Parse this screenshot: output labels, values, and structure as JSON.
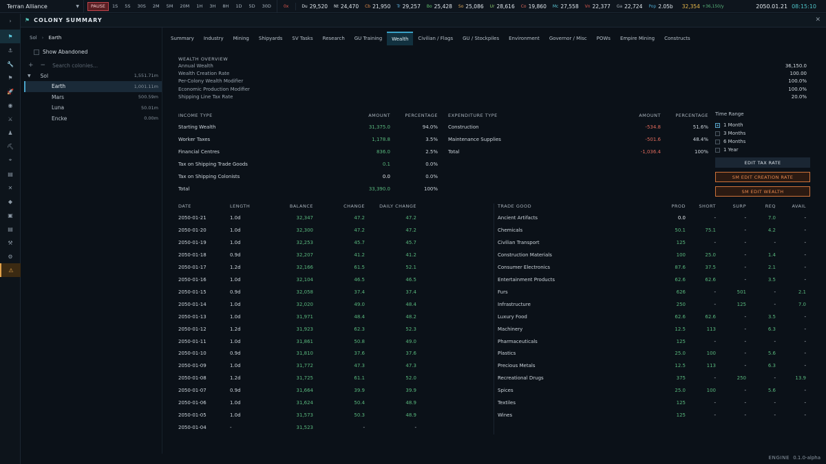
{
  "topbar": {
    "empire": "Terran Alliance",
    "speed_buttons": [
      "PAUSE",
      "1S",
      "5S",
      "30S",
      "2M",
      "5M",
      "20M",
      "1H",
      "3H",
      "8H",
      "1D",
      "5D",
      "30D"
    ],
    "resources": [
      {
        "label": "0x",
        "value": "",
        "color": "#e0584f"
      },
      {
        "label": "Du",
        "value": "29,520",
        "color": "#dfe6ec"
      },
      {
        "label": "Nt",
        "value": "24,470",
        "color": "#dfe6ec"
      },
      {
        "label": "Cb",
        "value": "21,950",
        "color": "#e28a4b"
      },
      {
        "label": "Tr",
        "value": "29,257",
        "color": "#5fb7e8"
      },
      {
        "label": "Bo",
        "value": "25,428",
        "color": "#62c36e"
      },
      {
        "label": "So",
        "value": "25,086",
        "color": "#e0a95a"
      },
      {
        "label": "Ur",
        "value": "28,616",
        "color": "#8fcf6f"
      },
      {
        "label": "Co",
        "value": "19,860",
        "color": "#e06a5c"
      },
      {
        "label": "Mc",
        "value": "27,558",
        "color": "#5bc8d6"
      },
      {
        "label": "Vn",
        "value": "22,377",
        "color": "#e0584f"
      },
      {
        "label": "Ga",
        "value": "22,724",
        "color": "#a6b0b9"
      },
      {
        "label": "Pop",
        "value": "2.05b",
        "color": "#4aa3c9"
      }
    ],
    "wealth": "32,354",
    "wealth_rate": "+36,150/y",
    "date": "2050.01.21",
    "time": "08:15:10"
  },
  "rail_icons": [
    "expand-icon",
    "flag-icon",
    "anchor-icon",
    "wrench-icon",
    "flag-small-icon",
    "rocket-icon",
    "target-icon",
    "swords-icon",
    "person-icon",
    "pickaxe-icon",
    "telescope-icon",
    "clipboard-icon",
    "cross-icon",
    "tag-icon",
    "box-icon",
    "document-icon",
    "tool-icon",
    "gear-icon",
    "warning-icon"
  ],
  "window": {
    "title": "COLONY SUMMARY"
  },
  "left": {
    "breadcrumb": [
      "Sol",
      "Earth"
    ],
    "show_abandoned": "Show Abandoned",
    "search_placeholder": "Search colonies...",
    "tree": [
      {
        "name": "Sol",
        "value": "1,551.71m",
        "indent": 0,
        "expand": "▼"
      },
      {
        "name": "Earth",
        "value": "1,001.11m",
        "indent": 1,
        "selected": true
      },
      {
        "name": "Mars",
        "value": "500.59m",
        "indent": 1
      },
      {
        "name": "Luna",
        "value": "50.01m",
        "indent": 1
      },
      {
        "name": "Encke",
        "value": "0.00m",
        "indent": 1
      }
    ]
  },
  "tabs": [
    "Summary",
    "Industry",
    "Mining",
    "Shipyards",
    "SV Tasks",
    "Research",
    "GU Training",
    "Wealth",
    "Civilian / Flags",
    "GU / Stockpiles",
    "Environment",
    "Governor / Misc",
    "POWs",
    "Empire Mining",
    "Constructs"
  ],
  "active_tab": "Wealth",
  "overview": {
    "title": "WEALTH OVERVIEW",
    "rows": [
      {
        "label": "Annual Wealth",
        "value": "36,150.0"
      },
      {
        "label": "Wealth Creation Rate",
        "value": "100.00"
      },
      {
        "label": "Per-Colony Wealth Modifier",
        "value": "100.0%"
      },
      {
        "label": "Economic Production Modifier",
        "value": "100.0%"
      },
      {
        "label": "Shipping Line Tax Rate",
        "value": "20.0%"
      }
    ]
  },
  "income": {
    "headers": [
      "INCOME TYPE",
      "AMOUNT",
      "PERCENTAGE"
    ],
    "rows": [
      {
        "type": "Starting Wealth",
        "amount": "31,375.0",
        "pct": "94.0%",
        "tone": "g"
      },
      {
        "type": "Worker Taxes",
        "amount": "1,178.8",
        "pct": "3.5%",
        "tone": "g"
      },
      {
        "type": "Financial Centres",
        "amount": "836.0",
        "pct": "2.5%",
        "tone": "g"
      },
      {
        "type": "Tax on Shipping Trade Goods",
        "amount": "0.1",
        "pct": "0.0%",
        "tone": "g"
      },
      {
        "type": "Tax on Shipping Colonists",
        "amount": "0.0",
        "pct": "0.0%",
        "tone": "w"
      },
      {
        "type": "Total",
        "amount": "33,390.0",
        "pct": "100%",
        "tone": "g"
      }
    ]
  },
  "expenditure": {
    "headers": [
      "EXPENDITURE TYPE",
      "AMOUNT",
      "PERCENTAGE"
    ],
    "rows": [
      {
        "type": "Construction",
        "amount": "-534.8",
        "pct": "51.6%"
      },
      {
        "type": "Maintenance Supplies",
        "amount": "-501.6",
        "pct": "48.4%"
      },
      {
        "type": "Total",
        "amount": "-1,036.4",
        "pct": "100%"
      }
    ]
  },
  "time_range": {
    "label": "Time Range",
    "options": [
      "1 Month",
      "3 Months",
      "6 Months",
      "1 Year"
    ],
    "selected": 0
  },
  "buttons": {
    "edit_tax": "EDIT TAX RATE",
    "sm_creation": "SM EDIT CREATION RATE",
    "sm_wealth": "SM EDIT WEALTH"
  },
  "history": {
    "headers": [
      "DATE",
      "LENGTH",
      "BALANCE",
      "CHANGE",
      "DAILY CHANGE"
    ],
    "rows": [
      [
        "2050-01-21",
        "1.0d",
        "32,347",
        "47.2",
        "47.2"
      ],
      [
        "2050-01-20",
        "1.0d",
        "32,300",
        "47.2",
        "47.2"
      ],
      [
        "2050-01-19",
        "1.0d",
        "32,253",
        "45.7",
        "45.7"
      ],
      [
        "2050-01-18",
        "0.9d",
        "32,207",
        "41.2",
        "41.2"
      ],
      [
        "2050-01-17",
        "1.2d",
        "32,166",
        "61.5",
        "52.1"
      ],
      [
        "2050-01-16",
        "1.0d",
        "32,104",
        "46.5",
        "46.5"
      ],
      [
        "2050-01-15",
        "0.9d",
        "32,058",
        "37.4",
        "37.4"
      ],
      [
        "2050-01-14",
        "1.0d",
        "32,020",
        "49.0",
        "48.4"
      ],
      [
        "2050-01-13",
        "1.0d",
        "31,971",
        "48.4",
        "48.2"
      ],
      [
        "2050-01-12",
        "1.2d",
        "31,923",
        "62.3",
        "52.3"
      ],
      [
        "2050-01-11",
        "1.0d",
        "31,861",
        "50.8",
        "49.0"
      ],
      [
        "2050-01-10",
        "0.9d",
        "31,810",
        "37.6",
        "37.6"
      ],
      [
        "2050-01-09",
        "1.0d",
        "31,772",
        "47.3",
        "47.3"
      ],
      [
        "2050-01-08",
        "1.2d",
        "31,725",
        "61.1",
        "52.0"
      ],
      [
        "2050-01-07",
        "0.9d",
        "31,664",
        "39.9",
        "39.9"
      ],
      [
        "2050-01-06",
        "1.0d",
        "31,624",
        "50.4",
        "48.9"
      ],
      [
        "2050-01-05",
        "1.0d",
        "31,573",
        "50.3",
        "48.9"
      ],
      [
        "2050-01-04",
        "-",
        "31,523",
        "-",
        "-"
      ]
    ]
  },
  "trade": {
    "headers": [
      "TRADE GOOD",
      "PROD",
      "SHORT",
      "SURP",
      "REQ",
      "AVAIL"
    ],
    "rows": [
      [
        "Ancient Artifacts",
        "0.0",
        "-",
        "-",
        "7.0",
        "-"
      ],
      [
        "Chemicals",
        "50.1",
        "75.1",
        "-",
        "4.2",
        "-"
      ],
      [
        "Civilian Transport",
        "125",
        "-",
        "-",
        "-",
        "-"
      ],
      [
        "Construction Materials",
        "100",
        "25.0",
        "-",
        "1.4",
        "-"
      ],
      [
        "Consumer Electronics",
        "87.6",
        "37.5",
        "-",
        "2.1",
        "-"
      ],
      [
        "Entertainment Products",
        "62.6",
        "62.6",
        "-",
        "3.5",
        "-"
      ],
      [
        "Furs",
        "626",
        "-",
        "501",
        "-",
        "2.1"
      ],
      [
        "Infrastructure",
        "250",
        "-",
        "125",
        "-",
        "7.0"
      ],
      [
        "Luxury Food",
        "62.6",
        "62.6",
        "-",
        "3.5",
        "-"
      ],
      [
        "Machinery",
        "12.5",
        "113",
        "-",
        "6.3",
        "-"
      ],
      [
        "Pharmaceuticals",
        "125",
        "-",
        "-",
        "-",
        "-"
      ],
      [
        "Plastics",
        "25.0",
        "100",
        "-",
        "5.6",
        "-"
      ],
      [
        "Precious Metals",
        "12.5",
        "113",
        "-",
        "6.3",
        "-"
      ],
      [
        "Recreational Drugs",
        "375",
        "-",
        "250",
        "-",
        "13.9"
      ],
      [
        "Spices",
        "25.0",
        "100",
        "-",
        "5.6",
        "-"
      ],
      [
        "Textiles",
        "125",
        "-",
        "-",
        "-",
        "-"
      ],
      [
        "Wines",
        "125",
        "-",
        "-",
        "-",
        "-"
      ]
    ]
  },
  "footer": {
    "engine": "ENGINE",
    "version": "0.1.0-alpha"
  }
}
